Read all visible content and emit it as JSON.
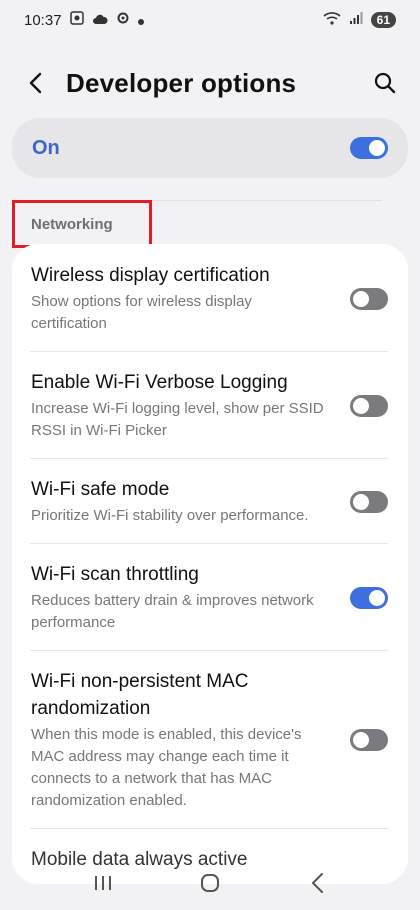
{
  "status_bar": {
    "time": "10:37",
    "battery": "61"
  },
  "header": {
    "title": "Developer options"
  },
  "master_switch": {
    "label": "On",
    "on": true
  },
  "section": {
    "label": "Networking"
  },
  "settings": [
    {
      "title": "Wireless display certification",
      "desc": "Show options for wireless display certification",
      "on": false
    },
    {
      "title": "Enable Wi-Fi Verbose Logging",
      "desc": "Increase Wi-Fi logging level, show per SSID RSSI in Wi-Fi Picker",
      "on": false
    },
    {
      "title": "Wi-Fi safe mode",
      "desc": "Prioritize Wi-Fi stability over performance.",
      "on": false
    },
    {
      "title": "Wi-Fi scan throttling",
      "desc": "Reduces battery drain & improves network performance",
      "on": true
    },
    {
      "title": "Wi-Fi non-persistent MAC randomization",
      "desc": "When this mode is enabled, this device's MAC address may change each time it connects to a network that has MAC randomization enabled.",
      "on": false
    },
    {
      "title": "Mobile data always active",
      "desc": "",
      "on": null
    }
  ],
  "colors": {
    "accent": "#3d6fe0",
    "highlight_border": "#e01e23"
  }
}
